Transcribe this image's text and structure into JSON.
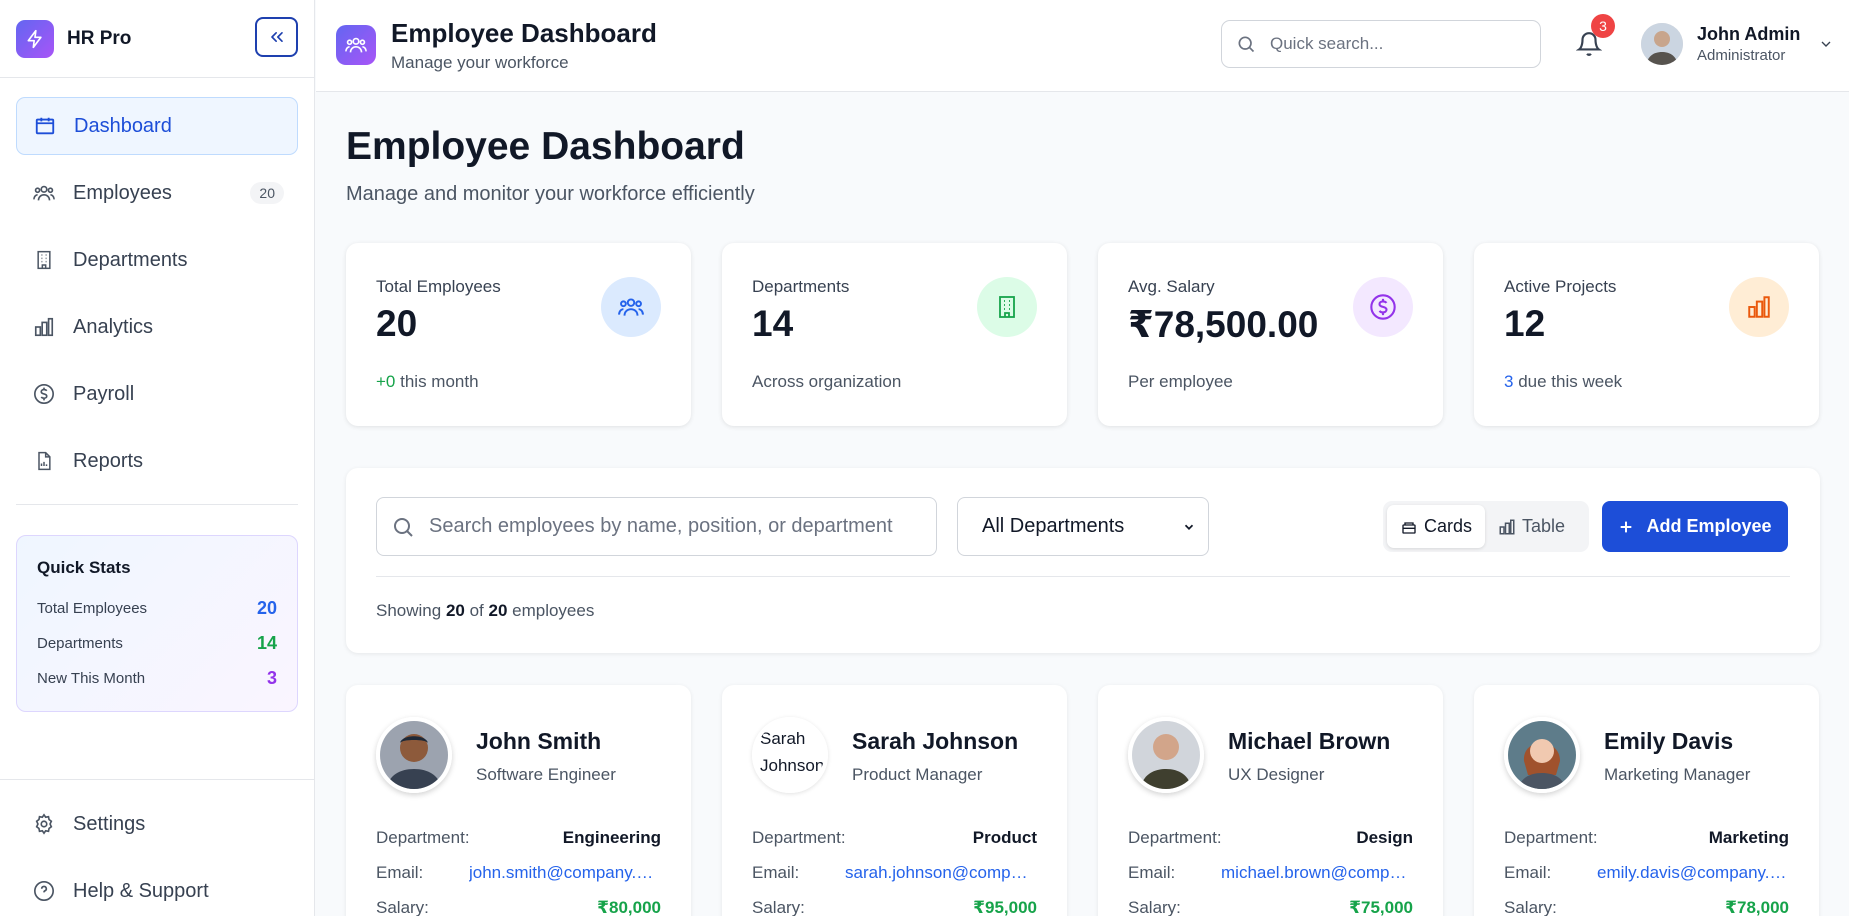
{
  "app": {
    "name": "HR Pro"
  },
  "sidebar": {
    "items": [
      {
        "label": "Dashboard",
        "icon": "calendar-icon"
      },
      {
        "label": "Employees",
        "icon": "users-icon",
        "badge": "20"
      },
      {
        "label": "Departments",
        "icon": "building-icon"
      },
      {
        "label": "Analytics",
        "icon": "bar-chart-icon"
      },
      {
        "label": "Payroll",
        "icon": "dollar-icon"
      },
      {
        "label": "Reports",
        "icon": "report-icon"
      }
    ],
    "quick_stats": {
      "title": "Quick Stats",
      "rows": [
        {
          "label": "Total Employees",
          "value": "20",
          "color": "#2563eb"
        },
        {
          "label": "Departments",
          "value": "14",
          "color": "#16a34a"
        },
        {
          "label": "New This Month",
          "value": "3",
          "color": "#9333ea"
        }
      ]
    },
    "bottom_items": [
      {
        "label": "Settings",
        "icon": "gear-icon"
      },
      {
        "label": "Help & Support",
        "icon": "help-icon"
      }
    ]
  },
  "topbar": {
    "title": "Employee Dashboard",
    "subtitle": "Manage your workforce",
    "search_placeholder": "Quick search...",
    "notification_count": "3",
    "user": {
      "name": "John Admin",
      "role": "Administrator"
    }
  },
  "main": {
    "title": "Employee Dashboard",
    "subtitle": "Manage and monitor your workforce efficiently",
    "stats": [
      {
        "label": "Total Employees",
        "value": "20",
        "foot_highlight": "+0",
        "foot_text": " this month",
        "highlight_color": "#16a34a",
        "icon_bg": "#dbeafe",
        "icon_color": "#2563eb",
        "icon": "users-icon"
      },
      {
        "label": "Departments",
        "value": "14",
        "foot_highlight": "",
        "foot_text": "Across organization",
        "highlight_color": "#16a34a",
        "icon_bg": "#dcfce7",
        "icon_color": "#16a34a",
        "icon": "building-icon"
      },
      {
        "label": "Avg. Salary",
        "value": "₹78,500.00",
        "foot_highlight": "",
        "foot_text": "Per employee",
        "highlight_color": "#16a34a",
        "icon_bg": "#f3e8ff",
        "icon_color": "#9333ea",
        "icon": "dollar-icon"
      },
      {
        "label": "Active Projects",
        "value": "12",
        "foot_highlight": "3",
        "foot_text": " due this week",
        "highlight_color": "#2563eb",
        "icon_bg": "#ffedd5",
        "icon_color": "#ea580c",
        "icon": "bar-chart-icon"
      }
    ],
    "filters": {
      "search_placeholder": "Search employees by name, position, or department",
      "department_selected": "All Departments",
      "view_cards": "Cards",
      "view_table": "Table",
      "add_button": "Add Employee",
      "showing_prefix": "Showing ",
      "showing_count": "20",
      "showing_of": " of ",
      "showing_total": "20",
      "showing_suffix": " employees"
    },
    "labels": {
      "department": "Department:",
      "email": "Email:",
      "salary": "Salary:"
    },
    "employees": [
      {
        "name": "John Smith",
        "position": "Software Engineer",
        "department": "Engineering",
        "email": "john.smith@company.com",
        "salary": "₹80,000"
      },
      {
        "name": "Sarah Johnson",
        "position": "Product Manager",
        "department": "Product",
        "email": "sarah.johnson@company.com",
        "salary": "₹95,000",
        "broken_alt": "Sarah Johnson"
      },
      {
        "name": "Michael Brown",
        "position": "UX Designer",
        "department": "Design",
        "email": "michael.brown@company.com",
        "salary": "₹75,000"
      },
      {
        "name": "Emily Davis",
        "position": "Marketing Manager",
        "department": "Marketing",
        "email": "emily.davis@company.com",
        "salary": "₹78,000"
      }
    ]
  }
}
